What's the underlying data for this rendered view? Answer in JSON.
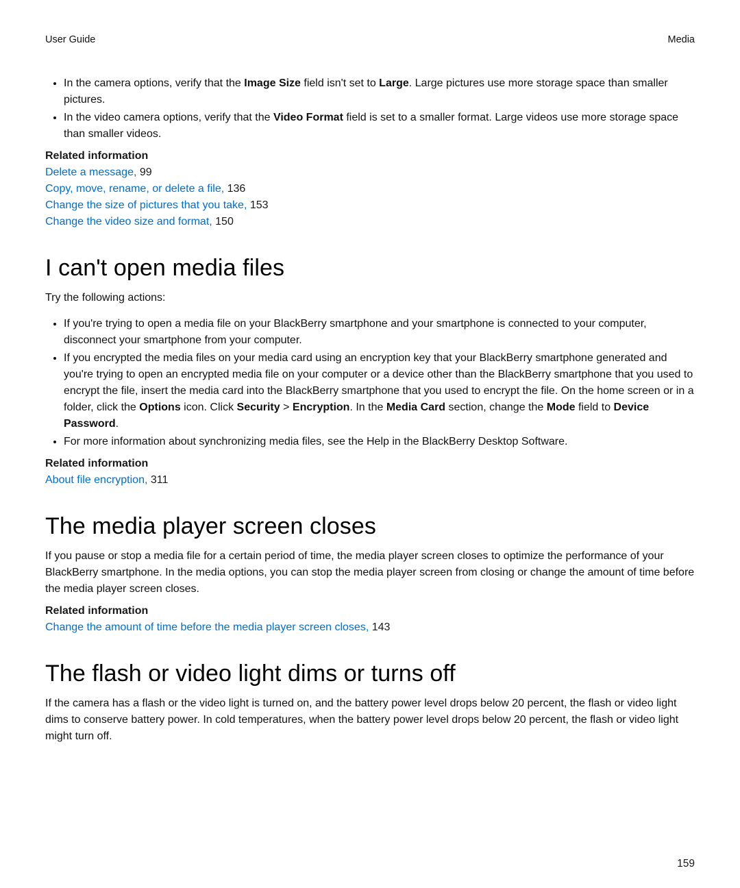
{
  "header": {
    "left": "User Guide",
    "right": "Media"
  },
  "bullets_top": [
    {
      "segments": [
        {
          "t": "In the camera options, verify that the "
        },
        {
          "t": "Image Size",
          "b": true
        },
        {
          "t": " field isn't set to "
        },
        {
          "t": "Large",
          "b": true
        },
        {
          "t": ". Large pictures use more storage space than smaller pictures."
        }
      ]
    },
    {
      "segments": [
        {
          "t": "In the video camera options, verify that the "
        },
        {
          "t": "Video Format",
          "b": true
        },
        {
          "t": " field is set to a smaller format. Large videos use more storage space than smaller videos."
        }
      ]
    }
  ],
  "related_label": "Related information",
  "rel1": [
    {
      "link": "Delete a message,",
      "page": "99"
    },
    {
      "link": "Copy, move, rename, or delete a file,",
      "page": "136"
    },
    {
      "link": "Change the size of pictures that you take,",
      "page": "153"
    },
    {
      "link": "Change the video size and format,",
      "page": "150"
    }
  ],
  "s1": {
    "heading": "I can't open media files",
    "intro": "Try the following actions:",
    "bullets": [
      {
        "segments": [
          {
            "t": "If you're trying to open a media file on your BlackBerry smartphone and your smartphone is connected to your computer, disconnect your smartphone from your computer."
          }
        ]
      },
      {
        "segments": [
          {
            "t": "If you encrypted the media files on your media card using an encryption key that your BlackBerry smartphone generated and you're trying to open an encrypted media file on your computer or a device other than the BlackBerry smartphone that you used to encrypt the file, insert the media card into the BlackBerry smartphone that you used to encrypt the file. On the home screen or in a folder, click the "
          },
          {
            "t": "Options",
            "b": true
          },
          {
            "t": " icon. Click "
          },
          {
            "t": "Security",
            "b": true
          },
          {
            "t": " > "
          },
          {
            "t": "Encryption",
            "b": true
          },
          {
            "t": ". In the "
          },
          {
            "t": "Media Card",
            "b": true
          },
          {
            "t": " section, change the "
          },
          {
            "t": "Mode",
            "b": true
          },
          {
            "t": " field to "
          },
          {
            "t": "Device Password",
            "b": true
          },
          {
            "t": "."
          }
        ]
      },
      {
        "segments": [
          {
            "t": "For more information about synchronizing media files, see the Help in the BlackBerry Desktop Software."
          }
        ]
      }
    ]
  },
  "rel2": [
    {
      "link": "About file encryption,",
      "page": "311"
    }
  ],
  "s2": {
    "heading": "The media player screen closes",
    "body": "If you pause or stop a media file for a certain period of time, the media player screen closes to optimize the performance of your BlackBerry smartphone. In the media options, you can stop the media player screen from closing or change the amount of time before the media player screen closes."
  },
  "rel3": [
    {
      "link": "Change the amount of time before the media player screen closes,",
      "page": "143"
    }
  ],
  "s3": {
    "heading": "The flash or video light dims or turns off",
    "body": "If the camera has a flash or the video light is turned on, and the battery power level drops below 20 percent, the flash or video light dims to conserve battery power. In cold temperatures, when the battery power level drops below 20 percent, the flash or video light might turn off."
  },
  "page_number": "159"
}
